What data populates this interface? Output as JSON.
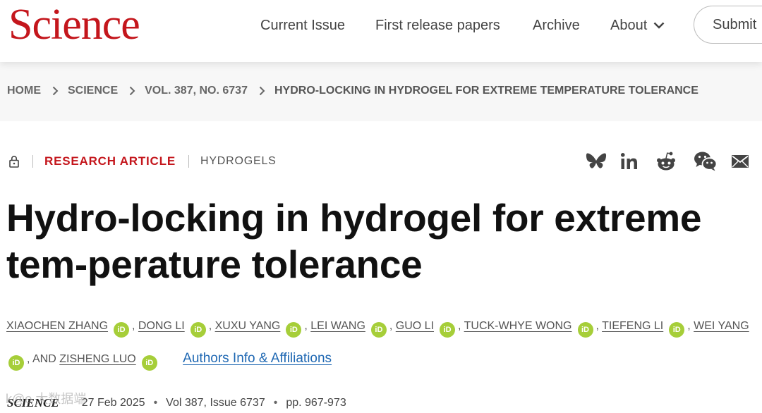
{
  "header": {
    "logo": "Science",
    "nav": {
      "current_issue": "Current Issue",
      "first_release": "First release papers",
      "archive": "Archive",
      "about": "About",
      "submit": "Submit"
    }
  },
  "breadcrumb": {
    "items": [
      "HOME",
      "SCIENCE",
      "VOL. 387, NO. 6737",
      "HYDRO-LOCKING IN HYDROGEL FOR EXTREME TEMPERATURE TOLERANCE"
    ]
  },
  "article": {
    "type": "RESEARCH ARTICLE",
    "subject": "HYDROGELS",
    "title": "Hydro-locking in hydrogel for extreme tem-perature tolerance",
    "authors": [
      "XIAOCHEN ZHANG",
      "DONG LI",
      "XUXU YANG",
      "LEI WANG",
      "GUO LI",
      "TUCK-WHYE WONG",
      "TIEFENG LI",
      "WEI YANG",
      "ZISHENG LUO"
    ],
    "orcid_label": "iD",
    "and_text": ", AND",
    "affiliations_link": "Authors Info & Affiliations",
    "journal": "SCIENCE",
    "date": "27 Feb 2025",
    "volume": "Vol 387, Issue 6737",
    "pages": "pp. 967-973",
    "watermark": "k@o 大数据端"
  },
  "share": {
    "icons": [
      "bluesky-icon",
      "linkedin-icon",
      "reddit-icon",
      "wechat-icon",
      "email-icon"
    ]
  },
  "colors": {
    "brand": "#c4161c",
    "orcid": "#a6ce39",
    "link": "#1f68b3"
  }
}
